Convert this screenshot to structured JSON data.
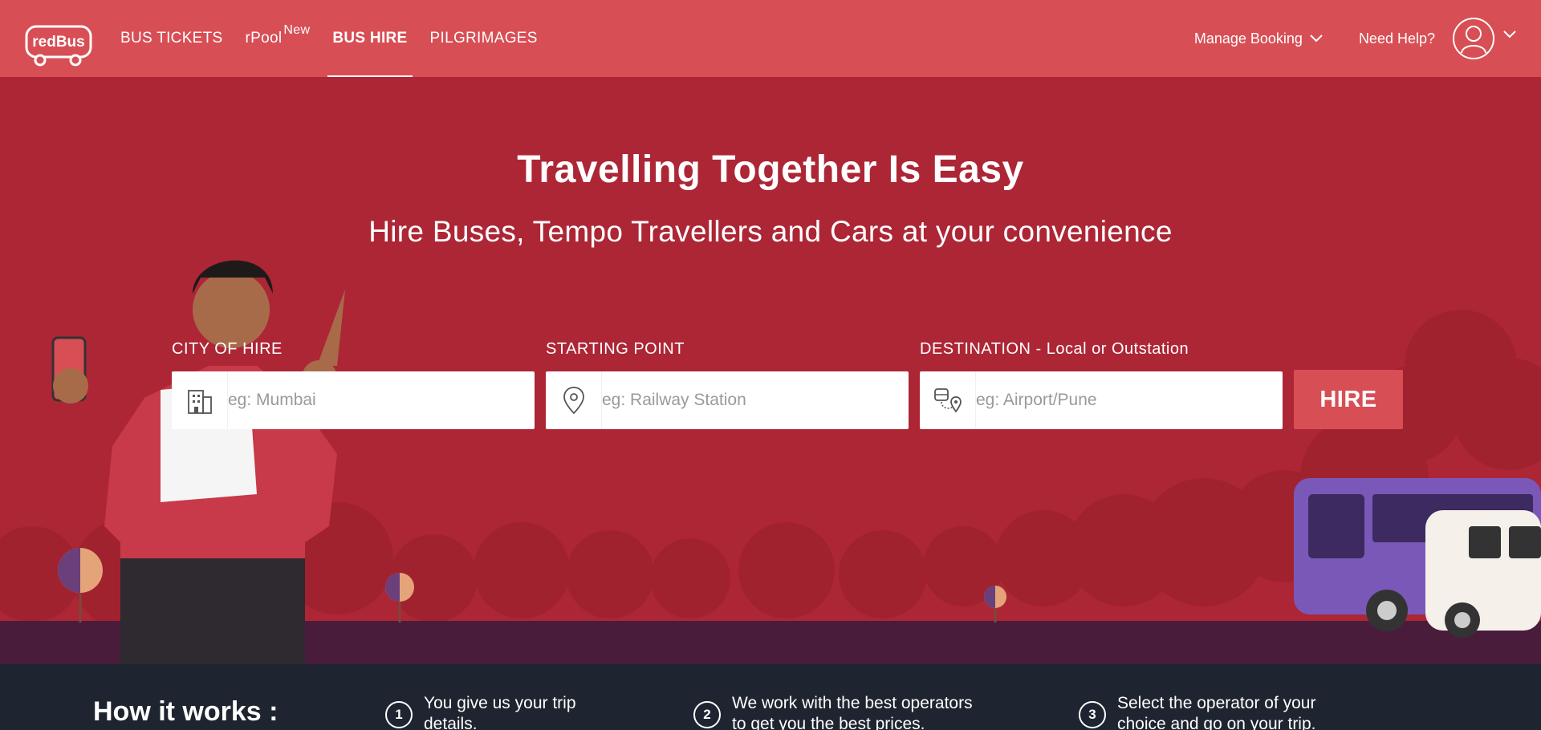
{
  "header": {
    "logo_text": "redBus",
    "nav": [
      {
        "label": "BUS TICKETS",
        "sup": ""
      },
      {
        "label": "rPool",
        "sup": "New"
      },
      {
        "label": "BUS HIRE",
        "sup": ""
      },
      {
        "label": "PILGRIMAGES",
        "sup": ""
      }
    ],
    "manage_booking": "Manage Booking",
    "need_help": "Need Help?"
  },
  "hero": {
    "title": "Travelling Together Is Easy",
    "subtitle": "Hire Buses, Tempo Travellers and Cars at your convenience",
    "fields": {
      "city": {
        "label": "CITY OF HIRE",
        "placeholder": "eg: Mumbai",
        "value": ""
      },
      "start": {
        "label": "STARTING POINT",
        "placeholder": "eg: Railway Station",
        "value": ""
      },
      "destination": {
        "label": "DESTINATION - Local or Outstation",
        "placeholder": "eg: Airport/Pune",
        "value": ""
      }
    },
    "hire_button": "HIRE"
  },
  "how_it_works": {
    "title": "How it works :",
    "steps": [
      {
        "num": "1",
        "line1": "You give us your trip",
        "line2": "details."
      },
      {
        "num": "2",
        "line1": "We work with the best operators",
        "line2": "to get you the best prices."
      },
      {
        "num": "3",
        "line1": "Select the operator of your",
        "line2": "choice and go on your trip."
      }
    ]
  },
  "colors": {
    "header_bg": "#d84e55",
    "hero_bg": "#ad2636",
    "ground": "#4a1c3c",
    "footer_bg": "#1e2530",
    "accent": "#d84e55"
  },
  "icons": [
    "redbus-logo",
    "chevron-down-icon",
    "user-icon",
    "building-icon",
    "location-pin-icon",
    "route-icon"
  ]
}
